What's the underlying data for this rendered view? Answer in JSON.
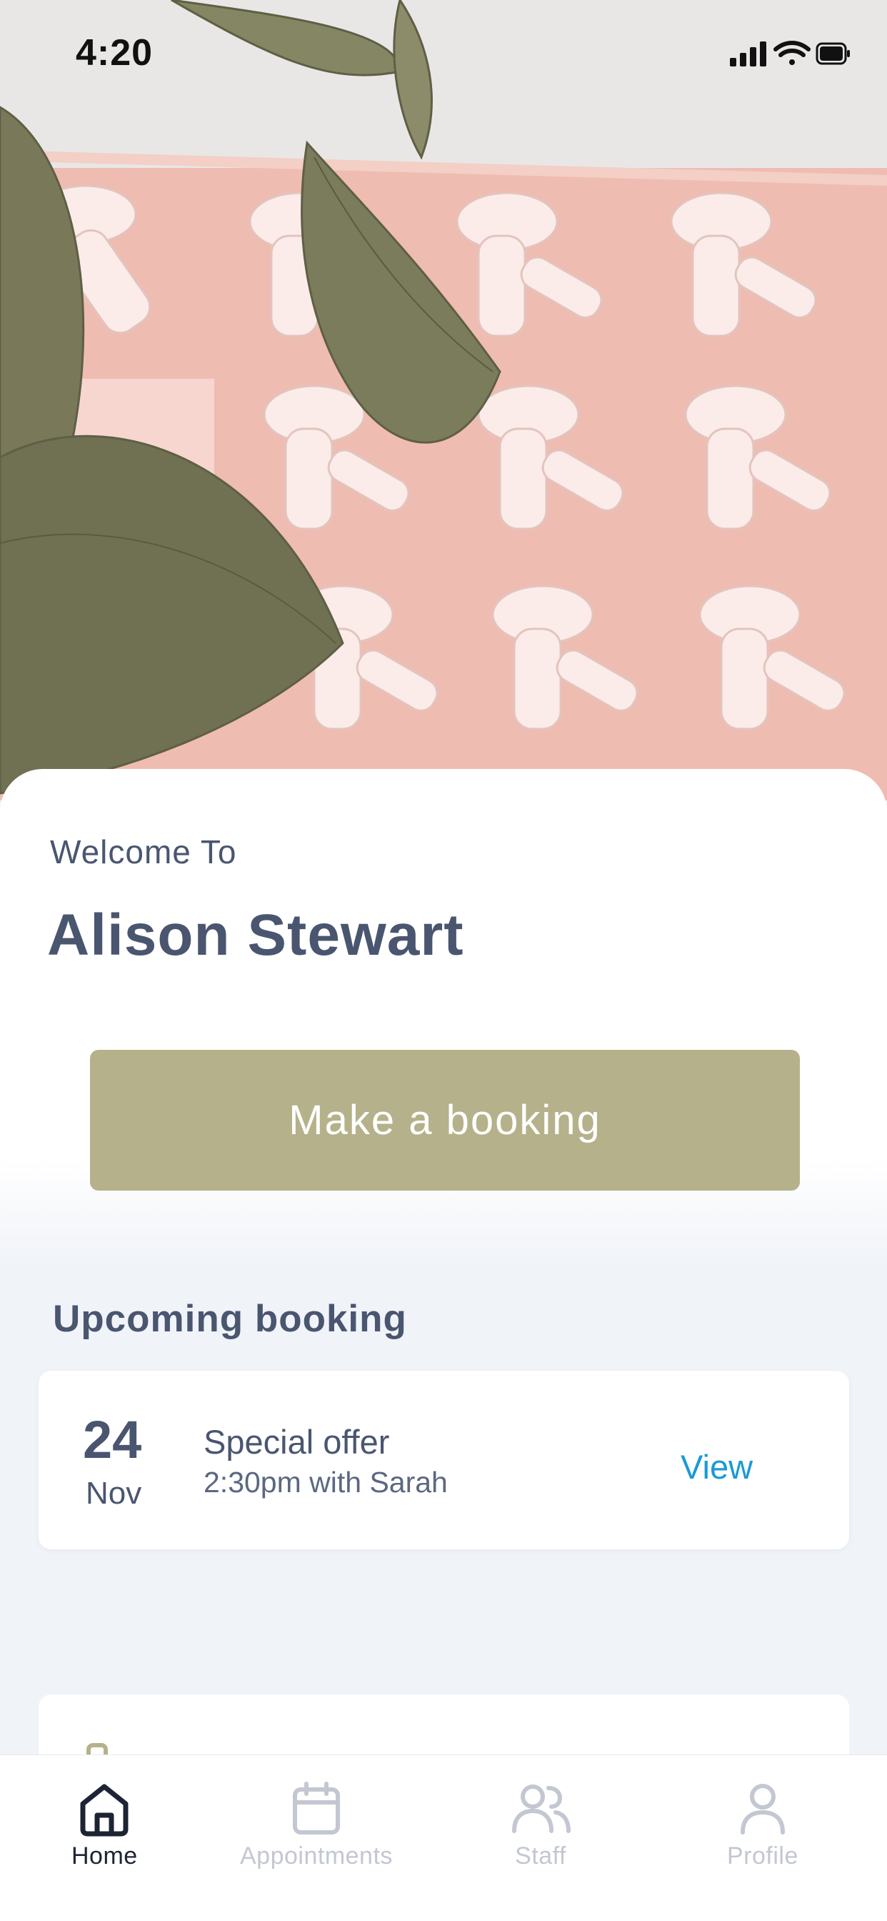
{
  "status_bar": {
    "time": "4:20"
  },
  "welcome": {
    "greeting": "Welcome To",
    "name": "Alison Stewart"
  },
  "actions": {
    "booking_button": "Make a booking"
  },
  "upcoming": {
    "title": "Upcoming booking",
    "booking": {
      "day": "24",
      "month": "Nov",
      "service": "Special offer",
      "details": "2:30pm with Sarah",
      "link": "View"
    }
  },
  "nav": {
    "items": [
      {
        "label": "Home",
        "icon": "home-icon",
        "active": true
      },
      {
        "label": "Appointments",
        "icon": "calendar-icon",
        "active": false
      },
      {
        "label": "Staff",
        "icon": "users-icon",
        "active": false
      },
      {
        "label": "Profile",
        "icon": "user-icon",
        "active": false
      }
    ]
  },
  "colors": {
    "accent": "#b5b18a",
    "text": "#4a5670",
    "link": "#1a9ad6",
    "hero_pink": "#eeb8ae"
  }
}
